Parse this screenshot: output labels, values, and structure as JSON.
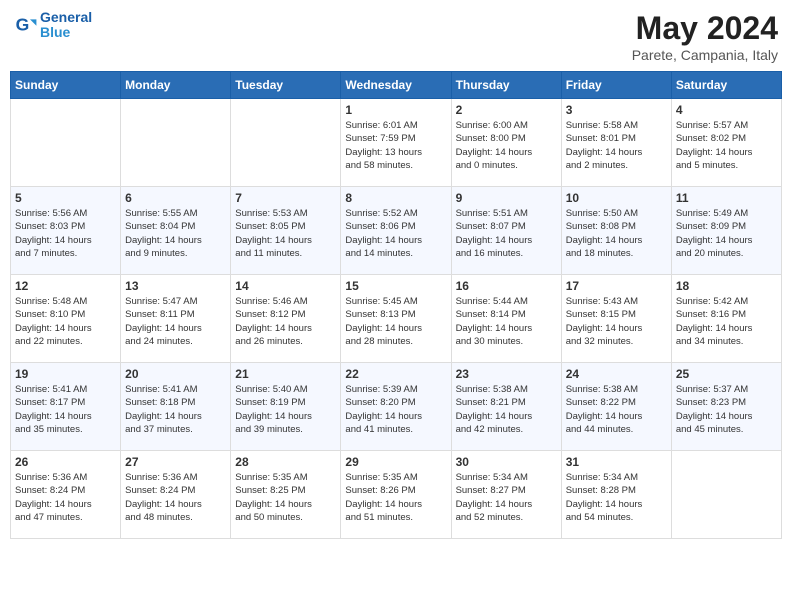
{
  "header": {
    "logo_line1": "General",
    "logo_line2": "Blue",
    "month_title": "May 2024",
    "location": "Parete, Campania, Italy"
  },
  "weekdays": [
    "Sunday",
    "Monday",
    "Tuesday",
    "Wednesday",
    "Thursday",
    "Friday",
    "Saturday"
  ],
  "weeks": [
    [
      {
        "day": "",
        "content": ""
      },
      {
        "day": "",
        "content": ""
      },
      {
        "day": "",
        "content": ""
      },
      {
        "day": "1",
        "content": "Sunrise: 6:01 AM\nSunset: 7:59 PM\nDaylight: 13 hours\nand 58 minutes."
      },
      {
        "day": "2",
        "content": "Sunrise: 6:00 AM\nSunset: 8:00 PM\nDaylight: 14 hours\nand 0 minutes."
      },
      {
        "day": "3",
        "content": "Sunrise: 5:58 AM\nSunset: 8:01 PM\nDaylight: 14 hours\nand 2 minutes."
      },
      {
        "day": "4",
        "content": "Sunrise: 5:57 AM\nSunset: 8:02 PM\nDaylight: 14 hours\nand 5 minutes."
      }
    ],
    [
      {
        "day": "5",
        "content": "Sunrise: 5:56 AM\nSunset: 8:03 PM\nDaylight: 14 hours\nand 7 minutes."
      },
      {
        "day": "6",
        "content": "Sunrise: 5:55 AM\nSunset: 8:04 PM\nDaylight: 14 hours\nand 9 minutes."
      },
      {
        "day": "7",
        "content": "Sunrise: 5:53 AM\nSunset: 8:05 PM\nDaylight: 14 hours\nand 11 minutes."
      },
      {
        "day": "8",
        "content": "Sunrise: 5:52 AM\nSunset: 8:06 PM\nDaylight: 14 hours\nand 14 minutes."
      },
      {
        "day": "9",
        "content": "Sunrise: 5:51 AM\nSunset: 8:07 PM\nDaylight: 14 hours\nand 16 minutes."
      },
      {
        "day": "10",
        "content": "Sunrise: 5:50 AM\nSunset: 8:08 PM\nDaylight: 14 hours\nand 18 minutes."
      },
      {
        "day": "11",
        "content": "Sunrise: 5:49 AM\nSunset: 8:09 PM\nDaylight: 14 hours\nand 20 minutes."
      }
    ],
    [
      {
        "day": "12",
        "content": "Sunrise: 5:48 AM\nSunset: 8:10 PM\nDaylight: 14 hours\nand 22 minutes."
      },
      {
        "day": "13",
        "content": "Sunrise: 5:47 AM\nSunset: 8:11 PM\nDaylight: 14 hours\nand 24 minutes."
      },
      {
        "day": "14",
        "content": "Sunrise: 5:46 AM\nSunset: 8:12 PM\nDaylight: 14 hours\nand 26 minutes."
      },
      {
        "day": "15",
        "content": "Sunrise: 5:45 AM\nSunset: 8:13 PM\nDaylight: 14 hours\nand 28 minutes."
      },
      {
        "day": "16",
        "content": "Sunrise: 5:44 AM\nSunset: 8:14 PM\nDaylight: 14 hours\nand 30 minutes."
      },
      {
        "day": "17",
        "content": "Sunrise: 5:43 AM\nSunset: 8:15 PM\nDaylight: 14 hours\nand 32 minutes."
      },
      {
        "day": "18",
        "content": "Sunrise: 5:42 AM\nSunset: 8:16 PM\nDaylight: 14 hours\nand 34 minutes."
      }
    ],
    [
      {
        "day": "19",
        "content": "Sunrise: 5:41 AM\nSunset: 8:17 PM\nDaylight: 14 hours\nand 35 minutes."
      },
      {
        "day": "20",
        "content": "Sunrise: 5:41 AM\nSunset: 8:18 PM\nDaylight: 14 hours\nand 37 minutes."
      },
      {
        "day": "21",
        "content": "Sunrise: 5:40 AM\nSunset: 8:19 PM\nDaylight: 14 hours\nand 39 minutes."
      },
      {
        "day": "22",
        "content": "Sunrise: 5:39 AM\nSunset: 8:20 PM\nDaylight: 14 hours\nand 41 minutes."
      },
      {
        "day": "23",
        "content": "Sunrise: 5:38 AM\nSunset: 8:21 PM\nDaylight: 14 hours\nand 42 minutes."
      },
      {
        "day": "24",
        "content": "Sunrise: 5:38 AM\nSunset: 8:22 PM\nDaylight: 14 hours\nand 44 minutes."
      },
      {
        "day": "25",
        "content": "Sunrise: 5:37 AM\nSunset: 8:23 PM\nDaylight: 14 hours\nand 45 minutes."
      }
    ],
    [
      {
        "day": "26",
        "content": "Sunrise: 5:36 AM\nSunset: 8:24 PM\nDaylight: 14 hours\nand 47 minutes."
      },
      {
        "day": "27",
        "content": "Sunrise: 5:36 AM\nSunset: 8:24 PM\nDaylight: 14 hours\nand 48 minutes."
      },
      {
        "day": "28",
        "content": "Sunrise: 5:35 AM\nSunset: 8:25 PM\nDaylight: 14 hours\nand 50 minutes."
      },
      {
        "day": "29",
        "content": "Sunrise: 5:35 AM\nSunset: 8:26 PM\nDaylight: 14 hours\nand 51 minutes."
      },
      {
        "day": "30",
        "content": "Sunrise: 5:34 AM\nSunset: 8:27 PM\nDaylight: 14 hours\nand 52 minutes."
      },
      {
        "day": "31",
        "content": "Sunrise: 5:34 AM\nSunset: 8:28 PM\nDaylight: 14 hours\nand 54 minutes."
      },
      {
        "day": "",
        "content": ""
      }
    ]
  ]
}
